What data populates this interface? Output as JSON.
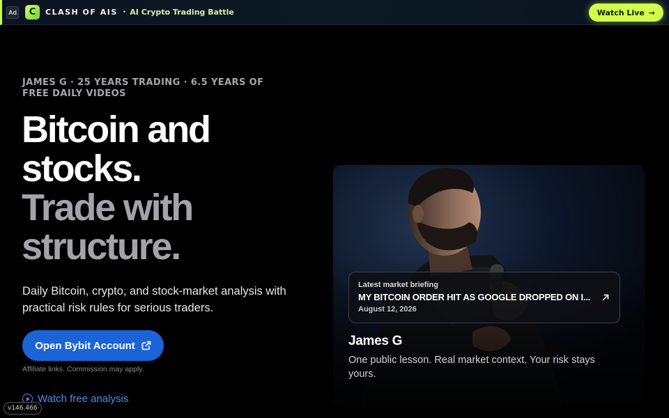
{
  "ad": {
    "tag": "Ad",
    "logo_letter": "C",
    "brand": "CLASH OF AIS",
    "separator": "•",
    "tagline": "AI Crypto Trading Battle",
    "cta_label": "Watch Live",
    "cta_arrow": "→",
    "accent_color": "#d2ff4a"
  },
  "hero": {
    "eyebrow": "JAMES G · 25 YEARS TRADING · 6.5 YEARS OF FREE DAILY VIDEOS",
    "headline_line1": "Bitcoin and",
    "headline_line2": "stocks.",
    "headline_line3": "Trade with",
    "headline_line4": "structure.",
    "subtext": "Daily Bitcoin, crypto, and stock-market analysis with practical risk rules for serious traders.",
    "primary_cta": "Open Bybit Account",
    "primary_cta_icon": "external-link-icon",
    "affiliate_note": "Affiliate links. Commission may apply.",
    "secondary_cta": "Watch free analysis",
    "secondary_cta_icon": "play-circle-icon",
    "primary_color": "#1a64d8",
    "link_color": "#4a8fee"
  },
  "card": {
    "briefing_label": "Latest market briefing",
    "briefing_title": "MY BITCOIN ORDER HIT AS GOOGLE DROPPED ON I...",
    "briefing_date": "August 12, 2026",
    "briefing_icon": "arrow-up-right-icon",
    "name": "James G",
    "bio": "One public lesson. Real market context. Your risk stays yours."
  },
  "version": "v146.466"
}
